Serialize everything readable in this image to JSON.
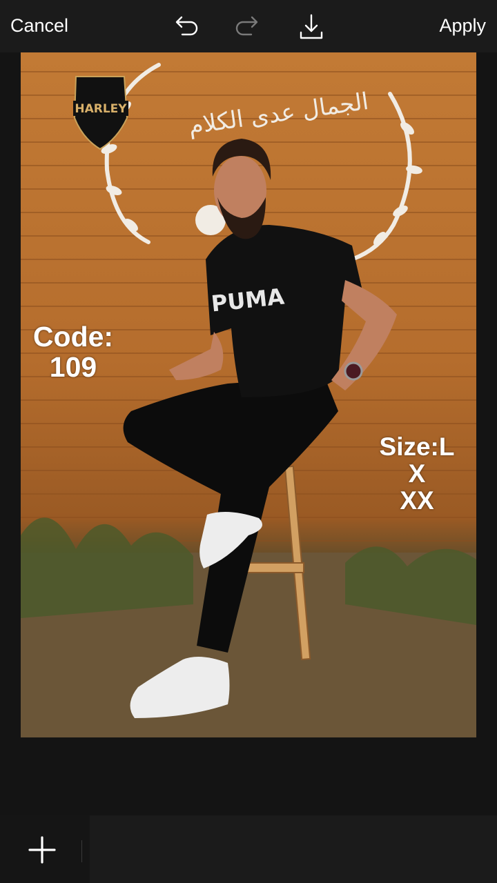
{
  "toolbar": {
    "cancel_label": "Cancel",
    "apply_label": "Apply",
    "icons": [
      "undo-icon",
      "redo-icon",
      "download-icon"
    ]
  },
  "photo": {
    "logo_text": "HARLEY",
    "wall_text": "الجمال عدى الكلام",
    "shirt_text": "PUMA",
    "code_text": "Code:\n109",
    "size_text": "Size:L\nX\nXX"
  },
  "bottom": {
    "icons": [
      "plus-icon"
    ]
  },
  "colors": {
    "bar_background": "#1b1b1b",
    "canvas_background": "#141414",
    "icon_white": "#ffffff",
    "icon_disabled": "#7a7a7a"
  }
}
